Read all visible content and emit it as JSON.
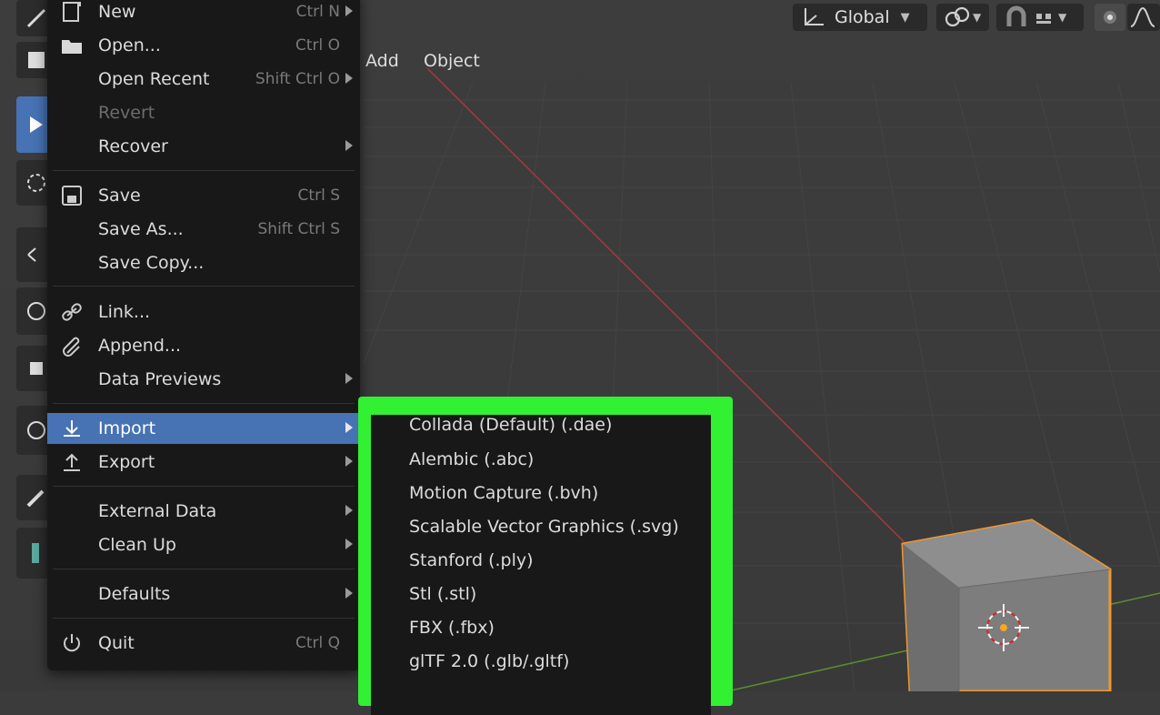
{
  "header": {
    "transform_orientation": "Global",
    "menubar": [
      "Add",
      "Object"
    ]
  },
  "file_menu": {
    "items": [
      {
        "label": "New",
        "shortcut": "Ctrl N",
        "submenu": true,
        "icon": "new-file-icon"
      },
      {
        "label": "Open...",
        "shortcut": "Ctrl O",
        "submenu": false,
        "icon": "folder-icon"
      },
      {
        "label": "Open Recent",
        "shortcut": "Shift Ctrl O",
        "submenu": true,
        "icon": ""
      },
      {
        "label": "Revert",
        "shortcut": "",
        "submenu": false,
        "icon": "",
        "disabled": true
      },
      {
        "label": "Recover",
        "shortcut": "",
        "submenu": true,
        "icon": ""
      },
      {
        "label": "Save",
        "shortcut": "Ctrl S",
        "submenu": false,
        "icon": "save-icon"
      },
      {
        "label": "Save As...",
        "shortcut": "Shift Ctrl S",
        "submenu": false,
        "icon": ""
      },
      {
        "label": "Save Copy...",
        "shortcut": "",
        "submenu": false,
        "icon": ""
      },
      {
        "label": "Link...",
        "shortcut": "",
        "submenu": false,
        "icon": "link-icon"
      },
      {
        "label": "Append...",
        "shortcut": "",
        "submenu": false,
        "icon": "paperclip-icon"
      },
      {
        "label": "Data Previews",
        "shortcut": "",
        "submenu": true,
        "icon": ""
      },
      {
        "label": "Import",
        "shortcut": "",
        "submenu": true,
        "icon": "import-icon",
        "highlighted": true
      },
      {
        "label": "Export",
        "shortcut": "",
        "submenu": true,
        "icon": "export-icon"
      },
      {
        "label": "External Data",
        "shortcut": "",
        "submenu": true,
        "icon": ""
      },
      {
        "label": "Clean Up",
        "shortcut": "",
        "submenu": true,
        "icon": ""
      },
      {
        "label": "Defaults",
        "shortcut": "",
        "submenu": true,
        "icon": ""
      },
      {
        "label": "Quit",
        "shortcut": "Ctrl Q",
        "submenu": false,
        "icon": "power-icon"
      }
    ]
  },
  "import_submenu": {
    "highlight_color": "#32f032",
    "items": [
      "Collada (Default) (.dae)",
      "Alembic (.abc)",
      "Motion Capture (.bvh)",
      "Scalable Vector Graphics (.svg)",
      "Stanford (.ply)",
      "Stl (.stl)",
      "FBX (.fbx)",
      "glTF 2.0 (.glb/.gltf)"
    ]
  },
  "colors": {
    "menu_bg": "#181818",
    "highlight": "#4772b3",
    "viewport_bg": "#3b3b3b",
    "selection_outline": "#f0962f"
  }
}
